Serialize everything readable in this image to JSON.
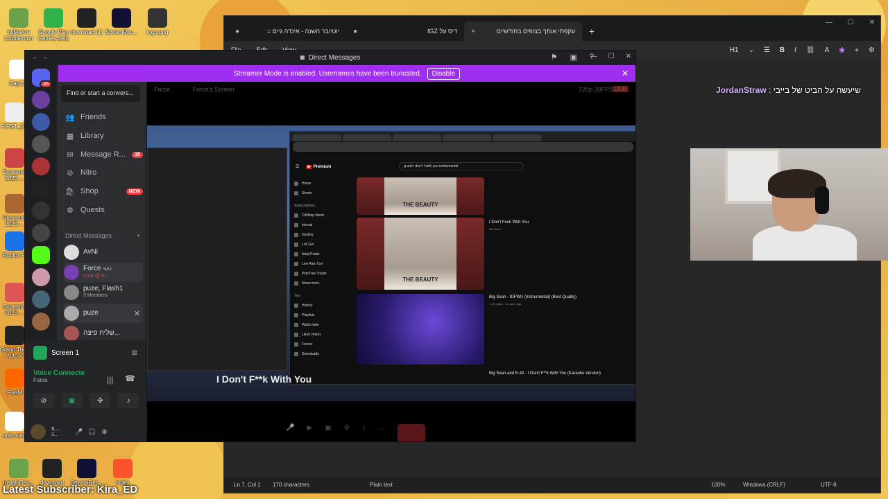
{
  "desktop": {
    "icons_left": [
      "ItsMeAre Cobblemon",
      "Google Play Games Beta",
      "download (1)",
      "StreamRec...",
      "logo.png",
      "CapCut",
      "FIRST_SK",
      "Screensh 2025-...",
      "Screensh 2025-...",
      "Roblox Pl",
      "Screensh 2025-...",
      "Grand Theft Auto V",
      "FiveM",
      "auto-start"
    ],
    "icons_bottom": [
      "Install Geo...",
      "download",
      "StreamRec...",
      "index"
    ],
    "latest_subscriber": "Latest Subscriber: Kira_ED"
  },
  "notepad": {
    "tabs": [
      {
        "label": "יוטיובר השנה - אינדה גיים =",
        "close": "●"
      },
      {
        "label": "דיס על IGZ",
        "close": "●"
      },
      {
        "label": "עקפתי אותך בצופים בחודשיים",
        "close": "×"
      }
    ],
    "add_tab": "+",
    "menu": [
      "File",
      "Edit",
      "View"
    ],
    "heading_select": "H1",
    "toolbar": [
      "B",
      "I",
      "⛓",
      "A"
    ],
    "status": {
      "position": "Ln 7, Col 1",
      "chars": "170 characters",
      "format": "Plain text",
      "zoom": "100%",
      "line_endings": "Windows (CRLF)",
      "encoding": "UTF-8"
    }
  },
  "chat": {
    "user": "JordanStraw",
    "message": "שיעשה על הביט של בייבי :"
  },
  "discord": {
    "title": "Direct Messages",
    "banner_text": "Streamer Mode is enabled. Usernames have been truncated.",
    "banner_button": "Disable",
    "server_badge": "35",
    "search_placeholder": "Find or start a convers...",
    "nav": [
      {
        "icon": "👥",
        "label": "Friends",
        "badge": ""
      },
      {
        "icon": "▦",
        "label": "Library",
        "badge": ""
      },
      {
        "icon": "✉",
        "label": "Message R...",
        "badge": "35"
      },
      {
        "icon": "⊘",
        "label": "Nitro",
        "badge": ""
      },
      {
        "icon": "🛍",
        "label": "Shop",
        "badge": "NEW"
      },
      {
        "icon": "⚙",
        "label": "Quests",
        "badge": ""
      }
    ],
    "dm_header": "Direct Messages",
    "dm_add": "+",
    "dms": [
      {
        "name": "AvNi",
        "sub": ""
      },
      {
        "name": "Force",
        "sub": "LIVE @ Ki...",
        "tag": "כושי"
      },
      {
        "name": "puze, Flash1",
        "sub": "3 Members"
      },
      {
        "name": "puze",
        "sub": ""
      },
      {
        "name": "שליח פיצה...",
        "sub": ""
      }
    ],
    "screen_label": "Screen 1",
    "voice_status": "Voice Connecte",
    "voice_channel": "Force",
    "user_name": "s...",
    "user_sub": "S...",
    "stream": {
      "viewer": "Force",
      "screen_title": "Force's Screen",
      "quality": "720p 30FPS",
      "live": "LIVE",
      "yt_search": "g unit i don't f with you instrumental",
      "yt_logo": "Premium",
      "yt_nav": [
        "Home",
        "Shorts"
      ],
      "yt_subs_header": "Subscriptions",
      "yt_subs": [
        "Chillhop Music",
        "shroud",
        "Destiny",
        "Lofi Girl",
        "NinjaTrader",
        "Live Alex Tzvi",
        "PineTree Trader"
      ],
      "yt_show_more": "Show more",
      "yt_you_header": "You",
      "yt_you": [
        "History",
        "Playlists",
        "Watch later",
        "Liked videos",
        "Forcee",
        "Downloads"
      ],
      "videos": [
        {
          "title": "I Don't Fuck With You",
          "meta": "2M views",
          "album": "THE BEAUTY"
        },
        {
          "title": "Big Sean - IDFWU (Instrumental) (Best Quality)",
          "meta": "1.1M views · 11 years ago",
          "album": ""
        },
        {
          "title": "Big Sean and E-40 - I Don't F**k With You (Karaoke Version)",
          "meta": "",
          "album": ""
        }
      ],
      "caption": "I Don't F**k With You"
    }
  }
}
